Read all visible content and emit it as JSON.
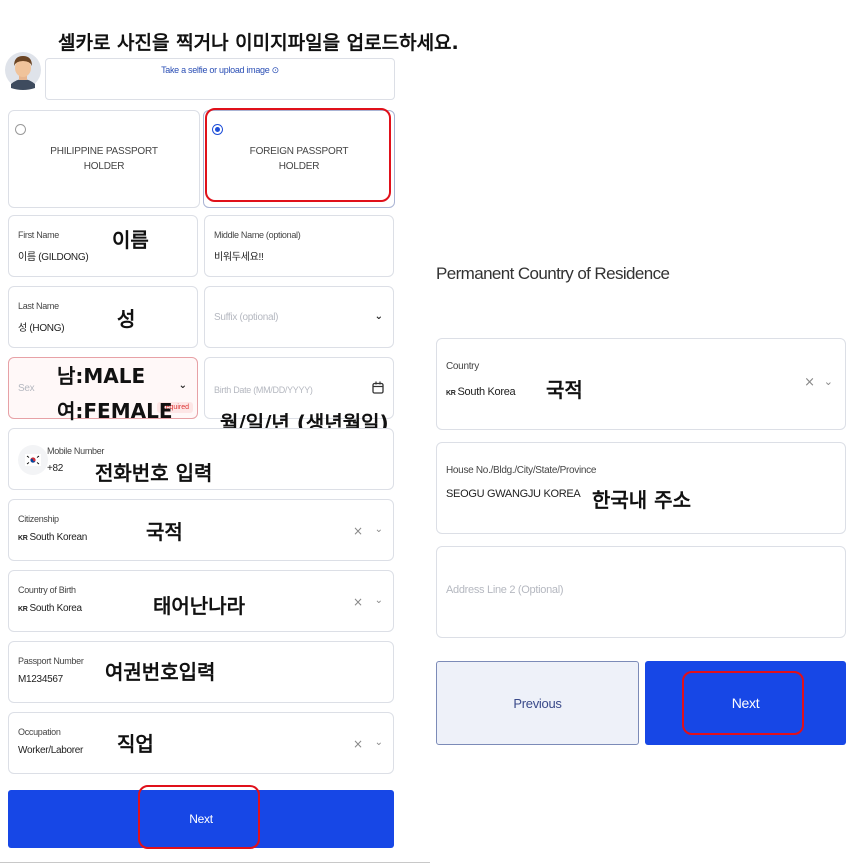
{
  "instruction_title": "셀카로 사진을 찍거나 이미지파일을 업로드하세요.",
  "photo": {
    "upload_text": "Take a selfie or upload image",
    "camera_icon": "camera-icon"
  },
  "passport_type": {
    "philippine": "PHILIPPINE PASSPORT HOLDER",
    "philippine_line1": "PHILIPPINE PASSPORT",
    "philippine_line2": "HOLDER",
    "foreign_line1": "FOREIGN PASSPORT",
    "foreign_line2": "HOLDER",
    "selected": "foreign"
  },
  "form": {
    "first_name": {
      "label": "First Name",
      "value": "이름 (GILDONG)"
    },
    "middle_name": {
      "label": "Middle Name (optional)",
      "value": "비워두세요!!"
    },
    "last_name": {
      "label": "Last Name",
      "value": "성 (HONG)"
    },
    "suffix": {
      "placeholder": "Suffix (optional)"
    },
    "sex": {
      "placeholder": "Sex",
      "required_badge": "Required"
    },
    "birth_date": {
      "placeholder": "Birth Date (MM/DD/YYYY)"
    },
    "mobile": {
      "label": "Mobile Number",
      "value": "+82"
    },
    "citizenship": {
      "label": "Citizenship",
      "country_code": "KR",
      "value": "South Korean"
    },
    "country_of_birth": {
      "label": "Country of Birth",
      "country_code": "KR",
      "value": "South Korea"
    },
    "passport_number": {
      "label": "Passport Number",
      "value": "M1234567"
    },
    "occupation": {
      "label": "Occupation",
      "value": "Worker/Laborer"
    },
    "next_label": "Next"
  },
  "residence": {
    "title": "Permanent Country of Residence",
    "country": {
      "label": "Country",
      "country_code": "KR",
      "value": "South Korea"
    },
    "address1": {
      "label": "House No./Bldg./City/State/Province",
      "value": "SEOGU GWANGJU KOREA"
    },
    "address2": {
      "placeholder": "Address Line 2 (Optional)"
    },
    "previous_label": "Previous",
    "next_label": "Next"
  },
  "annotations": {
    "first_name": "이름",
    "last_name": "성",
    "sex_male": "남:MALE",
    "sex_female": "여:FEMALE",
    "birth_date": "월/일/년 (생년월일)",
    "mobile": "전화번호 입력",
    "citizenship": "국적",
    "country_of_birth": "태어난나라",
    "passport": "여권번호입력",
    "occupation": "직업",
    "residence_country": "국적",
    "residence_address": "한국내 주소"
  },
  "colors": {
    "accent": "#1747e6",
    "highlight": "#e0101a",
    "selected_radio": "#1d4ed8"
  }
}
